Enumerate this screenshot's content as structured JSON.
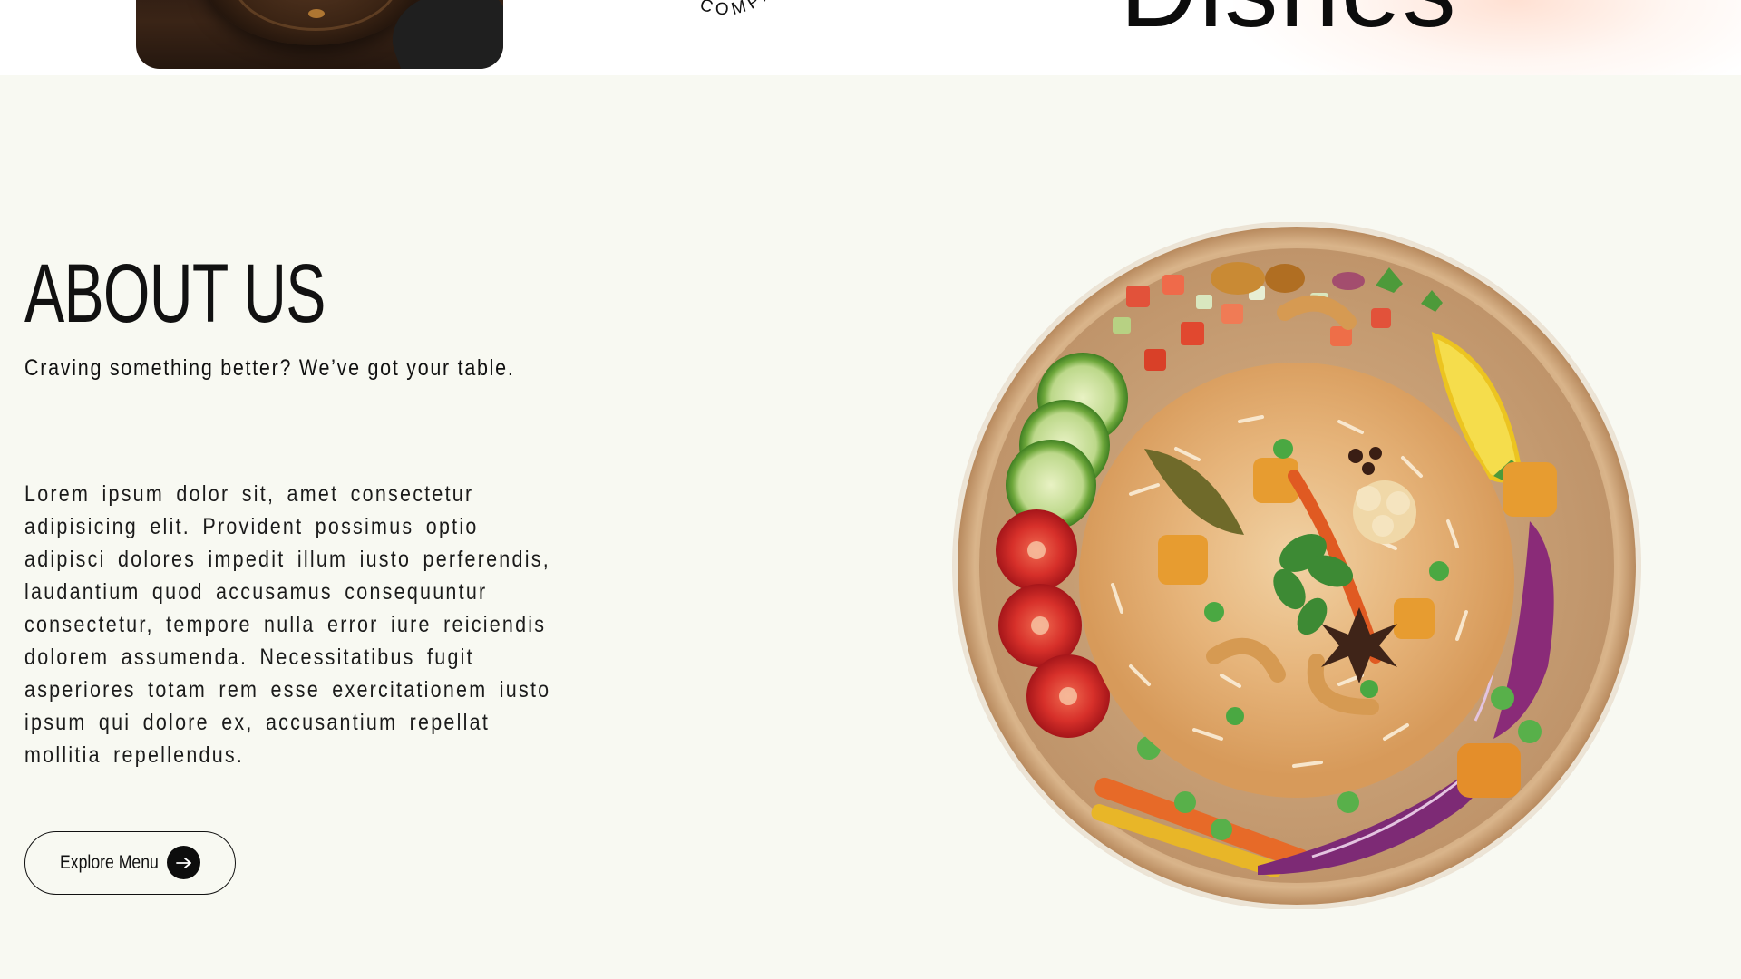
{
  "top_strip": {
    "stamp_fragment": "COMPA",
    "heading_fragment": "Dishes"
  },
  "about": {
    "title": "ABOUT US",
    "subtitle": "Craving something better? We’ve got your table.",
    "body": "Lorem ipsum dolor sit, amet consectetur adipisicing elit. Provident possimus optio adipisci dolores impedit illum iusto perferendis, laudantium quod accusamus consequuntur consectetur, tempore nulla error iure reiciendis dolorem assumenda. Necessitatibus fugit asperiores totam rem esse exercitationem iusto ipsum qui dolore ex, accusantium repellat mollitia repellendus.",
    "button_label": "Explore Menu",
    "button_icon": "arrow-right-icon"
  },
  "colors": {
    "page_background": "#f8f9f2",
    "text": "#111111",
    "button_icon_bg": "#0d0d0d"
  }
}
